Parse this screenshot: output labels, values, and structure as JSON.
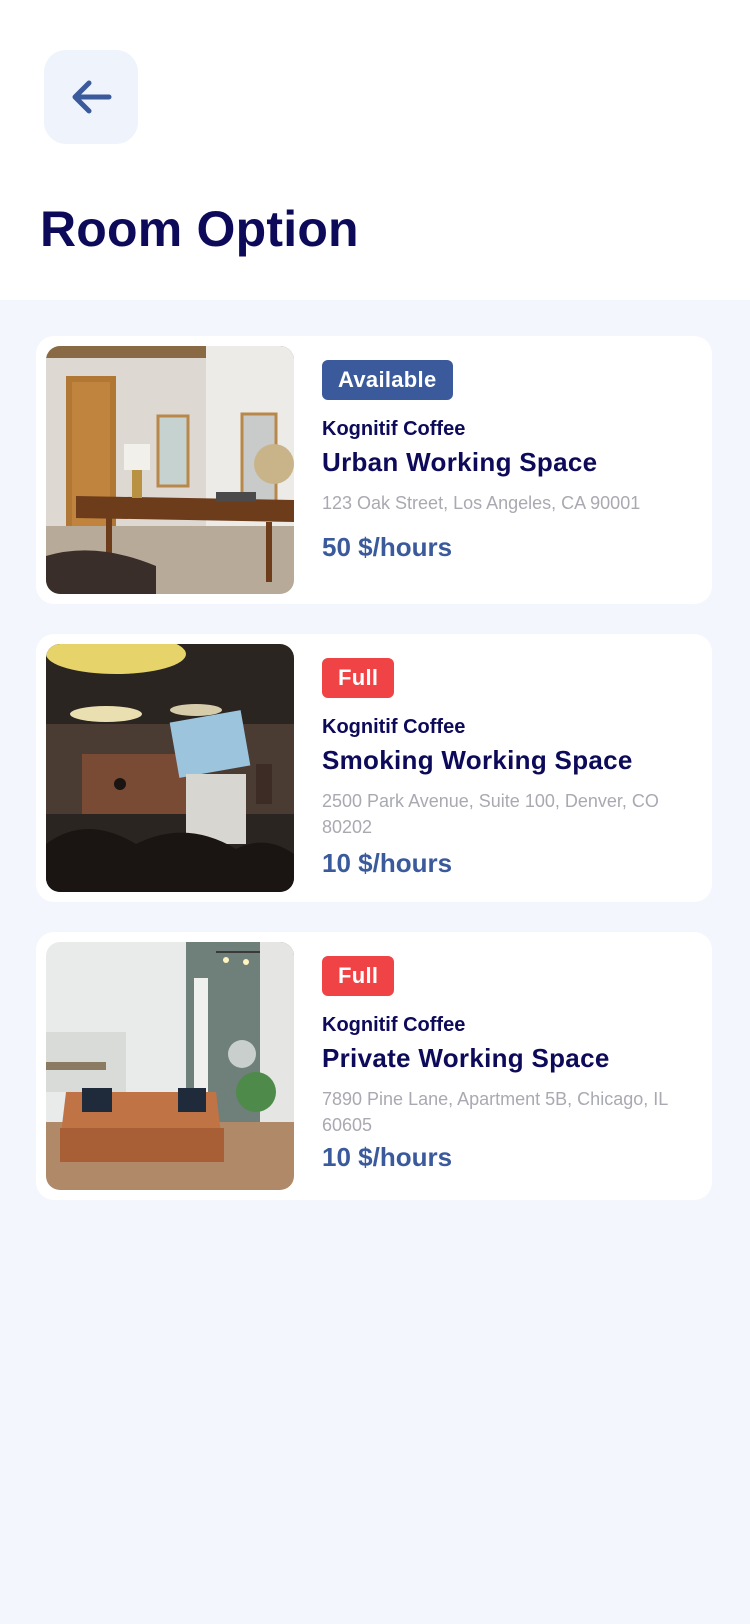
{
  "page": {
    "title": "Room Option"
  },
  "back_button": {
    "icon": "arrow-left-icon"
  },
  "colors": {
    "accent": "#3a5a9c",
    "title": "#0d0a5a",
    "available": "#3a5a9c",
    "full": "#f04345",
    "background": "#f3f6fd"
  },
  "rooms": [
    {
      "status": "Available",
      "brand": "Kognitif Coffee",
      "name": "Urban Working Space",
      "address": "123 Oak Street, Los Angeles, CA 90001",
      "price": "50 $/hours"
    },
    {
      "status": "Full",
      "brand": "Kognitif Coffee",
      "name": "Smoking Working Space",
      "address": "2500 Park Avenue, Suite 100, Denver, CO 80202",
      "price": "10 $/hours"
    },
    {
      "status": "Full",
      "brand": "Kognitif Coffee",
      "name": "Private Working Space",
      "address": "7890 Pine Lane, Apartment 5B, Chicago, IL 60605",
      "price": "10 $/hours"
    }
  ]
}
